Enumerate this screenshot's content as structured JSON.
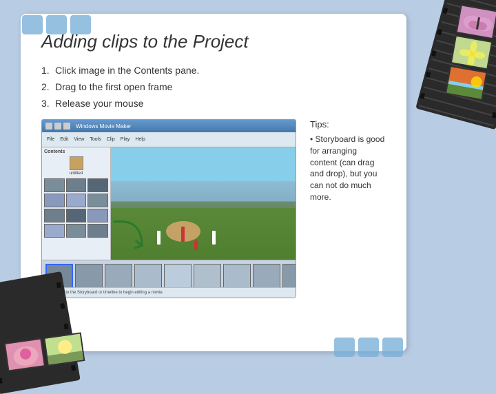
{
  "slide": {
    "title": "Adding clips to the Project",
    "steps": [
      {
        "number": "1.",
        "text": "Click image in the Contents pane."
      },
      {
        "number": "2.",
        "text": "Drag to the first open frame"
      },
      {
        "number": "3.",
        "text": "Release your mouse"
      }
    ]
  },
  "tips": {
    "title": "Tips:",
    "text": "• Storyboard is good for arranging content (can drag and drop), but you can not do much more."
  },
  "screenshot": {
    "titlebar": "Windows Movie Maker",
    "toolbar_items": [
      "File",
      "Edit",
      "View",
      "Tools",
      "Clip",
      "Play",
      "Help"
    ],
    "status_text": "Drag a clip to the Storyboard or timeline to begin editing a movie."
  },
  "decorations": {
    "filmstrip_visible": true,
    "blue_squares_count": 3
  }
}
